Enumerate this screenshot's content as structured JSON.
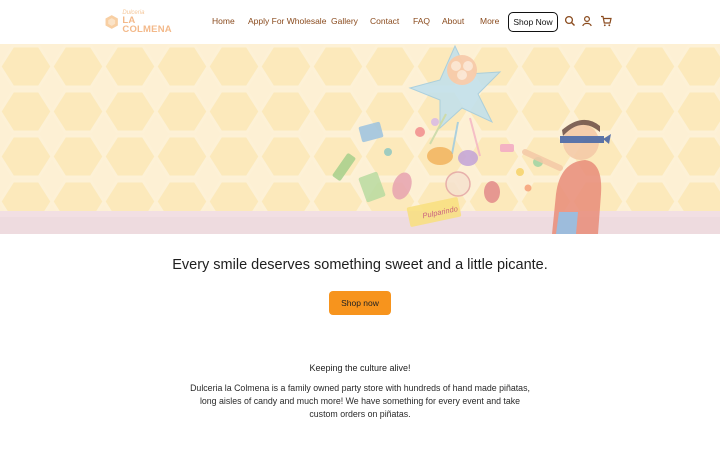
{
  "header": {
    "logo": {
      "top_text": "Dulceria",
      "main_text": "LA COLMENA",
      "icon": "honeycomb-logo-icon"
    },
    "nav": [
      {
        "label": "Home"
      },
      {
        "label": "Apply For Wholesale"
      },
      {
        "label": "Gallery"
      },
      {
        "label": "Contact"
      },
      {
        "label": "FAQ"
      },
      {
        "label": "About"
      },
      {
        "label": "More"
      }
    ],
    "shop_button": "Shop Now",
    "icons": [
      "search-icon",
      "account-icon",
      "cart-icon"
    ]
  },
  "hero": {
    "description_icons": [
      "pinata-star-icon",
      "blindfolded-child-icon",
      "candy-icon"
    ],
    "candy_label": "Pulparindo"
  },
  "main": {
    "tagline": "Every smile deserves something sweet and a little picante.",
    "cta_label": "Shop now",
    "subheading": "Keeping the culture alive!",
    "paragraph": "Dulceria la Colmena is a family owned party store with hundreds of hand made piñatas, long aisles of candy and much more! We have something for every event and take custom orders on piñatas."
  },
  "colors": {
    "accent": "#f7941d",
    "nav_text": "#8a4b1e",
    "hero_bg": "#fdf1d6"
  }
}
